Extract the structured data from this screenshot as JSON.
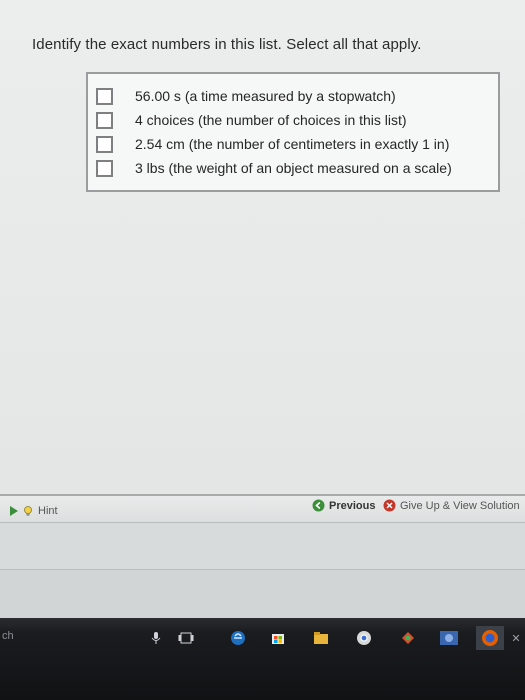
{
  "question": {
    "text": "Identify the exact numbers in this list. Select all that apply."
  },
  "choices": [
    {
      "label": "56.00 s  (a time measured by a stopwatch)",
      "checked": false
    },
    {
      "label": "4 choices (the number of choices in this list)",
      "checked": false
    },
    {
      "label": "2.54 cm (the number of centimeters in exactly 1 in)",
      "checked": false
    },
    {
      "label": "3 lbs (the weight of an object measured on a scale)",
      "checked": false
    }
  ],
  "buttons": {
    "hint": "Hint",
    "previous": "Previous",
    "give_up": "Give Up & View Solution"
  },
  "taskbar": {
    "search_fragment": "ch",
    "icons": [
      "microphone-icon",
      "task-view-icon",
      "edge-icon",
      "store-icon",
      "file-explorer-icon",
      "chrome-icon",
      "puzzle-app-icon",
      "photo-app-icon",
      "firefox-icon",
      "close-icon"
    ]
  },
  "colors": {
    "accent_green": "#3b8f3b",
    "give_up_red": "#c0392b"
  }
}
